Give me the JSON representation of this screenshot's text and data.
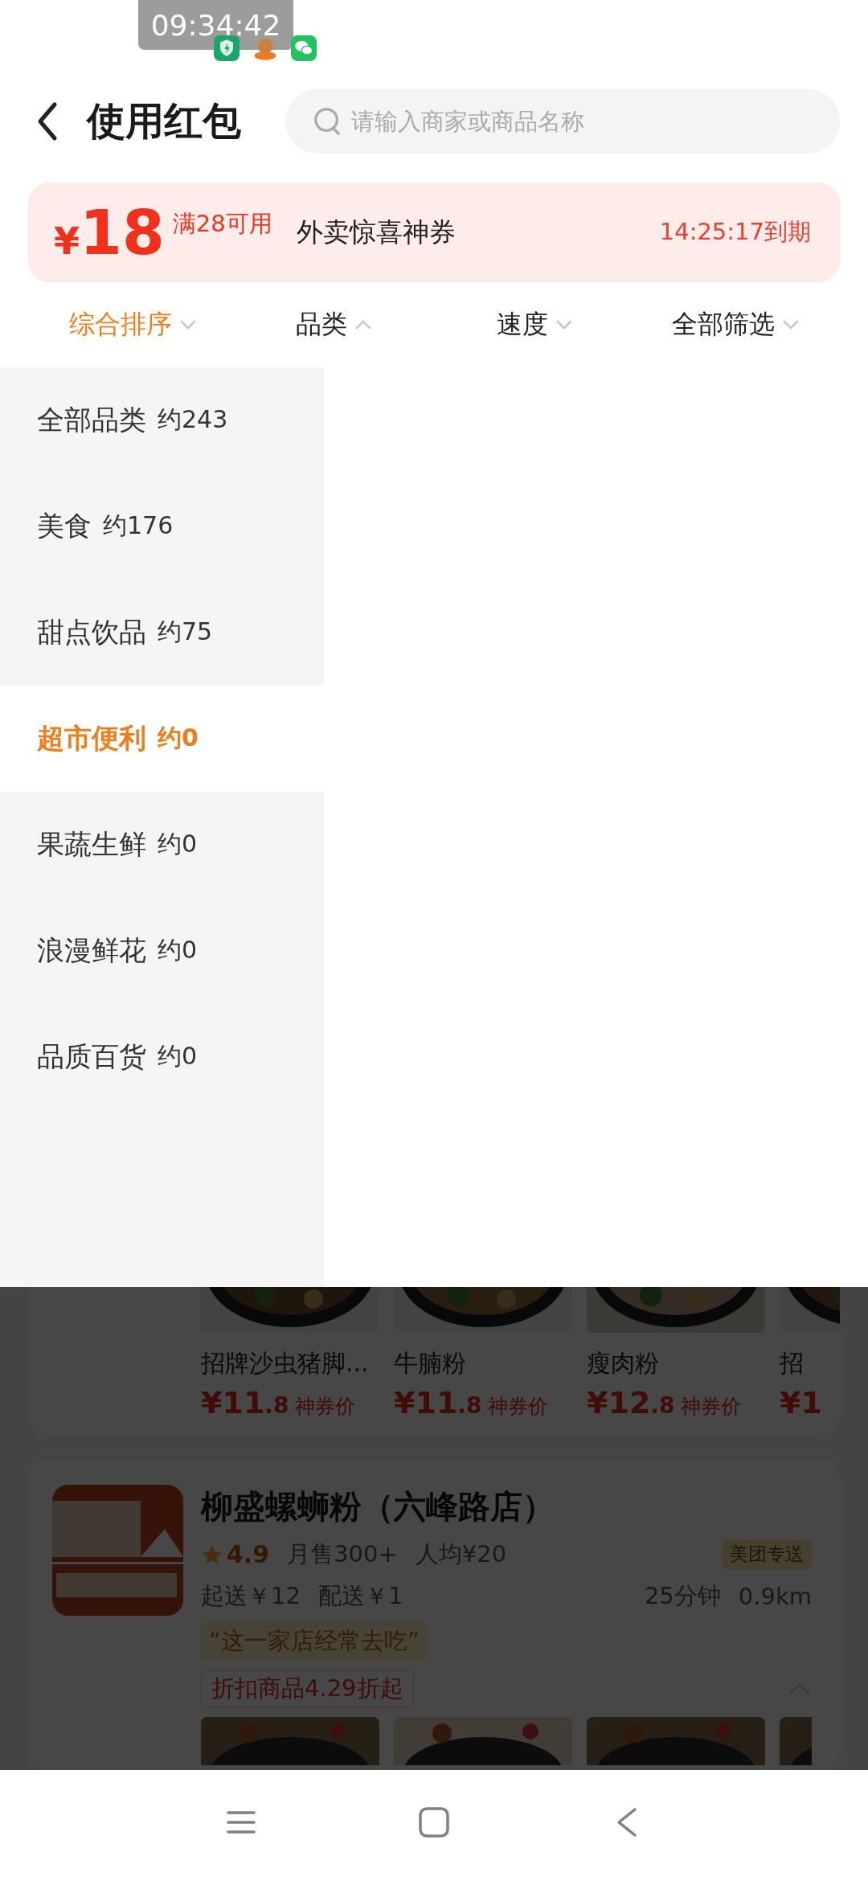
{
  "status": {
    "time": "09:34:42"
  },
  "header": {
    "title": "使用红包",
    "search": {
      "placeholder": "请输入商家或商品名称"
    }
  },
  "coupon": {
    "currency": "¥",
    "amount": "18",
    "condition": "满28可用",
    "name": "外卖惊喜神券",
    "expiry": "14:25:17到期"
  },
  "sort_bar": [
    {
      "label": "综合排序",
      "selected": true,
      "expanded": false
    },
    {
      "label": "品类",
      "selected": false,
      "expanded": true
    },
    {
      "label": "速度",
      "selected": false,
      "expanded": false
    },
    {
      "label": "全部筛选",
      "selected": false,
      "expanded": false
    }
  ],
  "category_menu": [
    {
      "label": "全部品类",
      "count": "约243",
      "selected": false
    },
    {
      "label": "美食",
      "count": "约176",
      "selected": false
    },
    {
      "label": "甜点饮品",
      "count": "约75",
      "selected": false
    },
    {
      "label": "超市便利",
      "count": "约0",
      "selected": true
    },
    {
      "label": "果蔬生鲜",
      "count": "约0",
      "selected": false
    },
    {
      "label": "浪漫鲜花",
      "count": "约0",
      "selected": false
    },
    {
      "label": "品质百货",
      "count": "约0",
      "selected": false
    }
  ],
  "products": [
    {
      "name": "招牌沙虫猪脚...",
      "price": "¥11",
      "decimal": ".8",
      "price_label": "神券价"
    },
    {
      "name": "牛腩粉",
      "price": "¥11",
      "decimal": ".8",
      "price_label": "神券价"
    },
    {
      "name": "瘦肉粉",
      "price": "¥12",
      "decimal": ".8",
      "price_label": "神券价"
    },
    {
      "name": "招",
      "price": "¥1"
    }
  ],
  "store": {
    "name": "柳盛螺蛳粉（六峰路店）",
    "rating": "4.9",
    "monthly_sales": "月售300+",
    "average_price": "人均¥20",
    "delivery_badge": "美团专送",
    "min_order": "起送￥12",
    "delivery_fee": "配送￥1",
    "delivery_time": "25分钟",
    "distance": "0.9km",
    "review_tag": "“这一家店经常去吃”",
    "discount_tag": "折扣商品4.29折起"
  }
}
